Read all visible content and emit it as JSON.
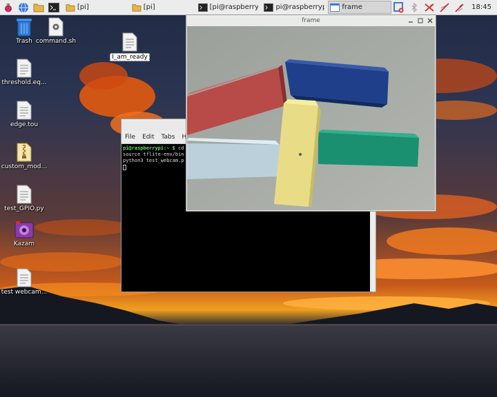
{
  "taskbar": {
    "tasks": [
      {
        "label": "[pi]",
        "icon": "folder-icon"
      },
      {
        "label": "[pi]",
        "icon": "folder-icon"
      },
      {
        "label": "[pi@raspberrypi: ~",
        "icon": "terminal-icon"
      },
      {
        "label": "pi@raspberrypi: ~",
        "icon": "terminal-icon"
      },
      {
        "label": "frame",
        "icon": "window-icon"
      }
    ],
    "clock": "18:45"
  },
  "desktop": {
    "icons": [
      {
        "label": "Trash",
        "icon": "trash-icon"
      },
      {
        "label": "command.sh",
        "icon": "script-icon"
      },
      {
        "label": "I_am_ready",
        "icon": "text-file-icon"
      },
      {
        "label": "threshold.eq...",
        "icon": "text-file-icon"
      },
      {
        "label": "edge.tou",
        "icon": "text-file-icon"
      },
      {
        "label": "custom_mod...",
        "icon": "archive-icon"
      },
      {
        "label": "test_GPIO.py",
        "icon": "text-file-icon"
      },
      {
        "label": "Kazam",
        "icon": "kazam-icon"
      },
      {
        "label": "test webcam...",
        "icon": "text-file-icon"
      }
    ]
  },
  "terminal": {
    "menu": [
      "File",
      "Edit",
      "Tabs",
      "Hel"
    ],
    "prompt": "pi@raspberrypi:~ $",
    "line1_cmd": " cd",
    "line2": "source tflite-env/bin",
    "line3": "python3 test_webcam.p"
  },
  "frame_window": {
    "title": "frame"
  }
}
